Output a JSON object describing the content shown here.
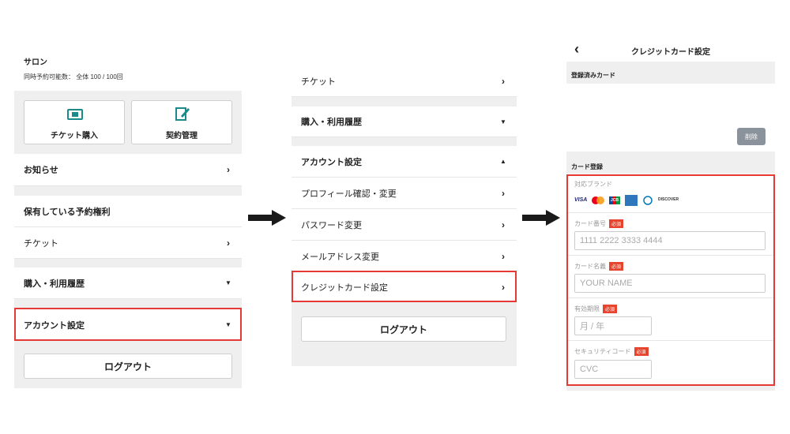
{
  "panel1": {
    "salon_label": "サロン",
    "reservation_info": "同時予約可能数： 全体 100 / 100回",
    "ticket_purchase_label": "チケット購入",
    "contract_manage_label": "契約管理",
    "notice_label": "お知らせ",
    "rights_header": "保有している予約権利",
    "ticket_label": "チケット",
    "history_label": "購入・利用履歴",
    "account_label": "アカウント設定",
    "logout_label": "ログアウト"
  },
  "panel2": {
    "ticket_label": "チケット",
    "history_label": "購入・利用履歴",
    "account_label": "アカウント設定",
    "profile_label": "プロフィール確認・変更",
    "password_label": "パスワード変更",
    "email_label": "メールアドレス変更",
    "credit_label": "クレジットカード設定",
    "logout_label": "ログアウト"
  },
  "panel3": {
    "back_icon": "‹",
    "title": "クレジットカード設定",
    "registered_header": "登録済みカード",
    "delete_label": "削除",
    "register_header": "カード登録",
    "brands_label": "対応ブランド",
    "brands": [
      "VISA",
      "Mastercard",
      "JCB",
      "AMEX",
      "Diners",
      "DISCOVER"
    ],
    "card_number_label": "カード番号",
    "card_number_placeholder": "1111 2222 3333 4444",
    "card_name_label": "カード名義",
    "card_name_placeholder": "YOUR NAME",
    "expiry_label": "有効期限",
    "expiry_placeholder": "月 / 年",
    "cvc_label": "セキュリティコード",
    "cvc_placeholder": "CVC",
    "required_label": "必須"
  },
  "colors": {
    "highlight": "#e53935",
    "required": "#e8432c",
    "accent_icon": "#1a8a8a",
    "delete_btn": "#8a939b"
  }
}
